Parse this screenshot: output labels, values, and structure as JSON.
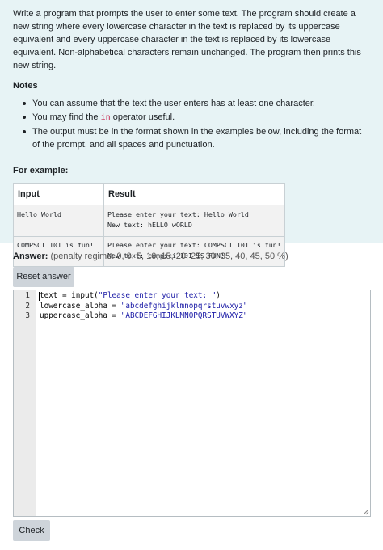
{
  "question": {
    "paragraph": "Write a program that prompts the user to enter some text. The program should create a new string where every lowercase character in the text is replaced by its uppercase equivalent and every uppercase character in the text is replaced by its lowercase equivalent. Non-alphabetical characters remain unchanged. The program then prints this new string.",
    "notes_heading": "Notes",
    "notes": [
      {
        "text": "You can assume that the text the user enters has at least one character."
      },
      {
        "before": "You may find the ",
        "code": "in",
        "after": " operator useful."
      },
      {
        "text": "The output must be in the format shown in the examples below, including the format of the prompt, and all spaces and punctuation."
      }
    ],
    "for_example": "For example:",
    "table": {
      "headers": [
        "Input",
        "Result"
      ],
      "rows": [
        {
          "input": "Hello World",
          "result": "Please enter your text: Hello World\nNew text: hELLO wORLD"
        },
        {
          "input": "COMPSCI 101 is fun!",
          "result": "Please enter your text: COMPSCI 101 is fun!\nNew text: compsci 101 IS FUN!"
        }
      ]
    }
  },
  "answer": {
    "label": "Answer:",
    "penalty": "(penalty regime: 0, 0, 5, 10, 15, 20, 25, 30, 35, 40, 45, 50 %)"
  },
  "buttons": {
    "reset": "Reset answer",
    "check": "Check"
  },
  "editor": {
    "line_numbers": [
      "1",
      "2",
      "3"
    ],
    "lines": [
      {
        "pre": "text = input(",
        "str": "\"Please enter your text: \"",
        "post": ")"
      },
      {
        "pre": "lowercase_alpha = ",
        "str": "\"abcdefghijklmnopqrstuvwxyz\"",
        "post": ""
      },
      {
        "pre": "uppercase_alpha = ",
        "str": "\"ABCDEFGHIJKLMNOPQRSTUVWXYZ\"",
        "post": ""
      }
    ]
  },
  "colors": {
    "question_bg": "#e7f3f5",
    "button_bg": "#ced4da",
    "string_color": "#1a1aa6",
    "inline_code": "#c7254e"
  }
}
